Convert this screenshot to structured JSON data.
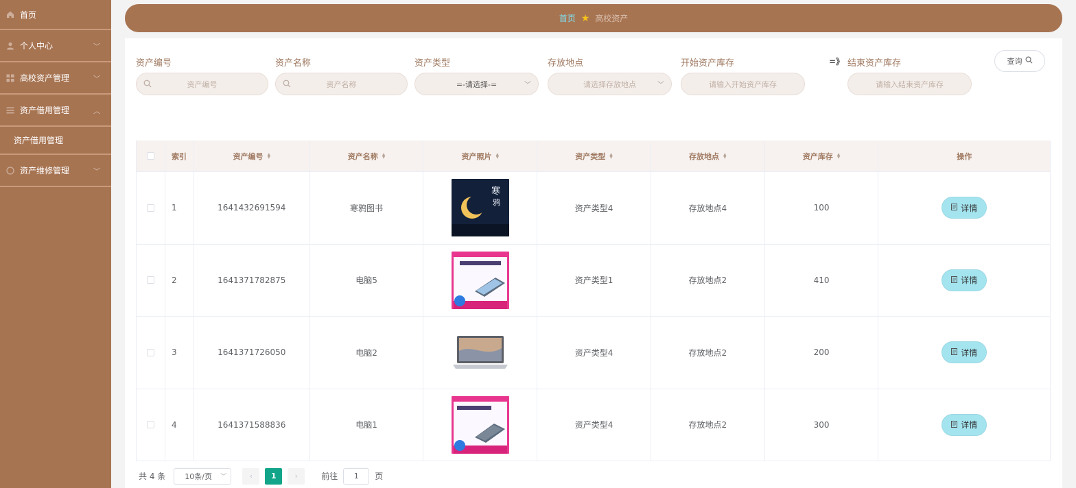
{
  "sidebar": {
    "items": [
      {
        "label": "首页",
        "icon": "home-icon"
      },
      {
        "label": "个人中心",
        "icon": "user-icon"
      },
      {
        "label": "高校资产管理",
        "icon": "grid-icon"
      },
      {
        "label": "资产借用管理",
        "icon": "list-icon"
      },
      {
        "sub_label": "资产借用管理"
      },
      {
        "label": "资产维修管理",
        "icon": "circle-icon"
      }
    ]
  },
  "breadcrumb": {
    "home": "首页",
    "current": "高校资产"
  },
  "filters": {
    "asset_no_label": "资产编号",
    "asset_no_placeholder": "资产编号",
    "asset_name_label": "资产名称",
    "asset_name_placeholder": "资产名称",
    "asset_type_label": "资产类型",
    "asset_type_value": "=-请选择-=",
    "location_label": "存放地点",
    "location_placeholder": "请选择存放地点",
    "stock_start_label": "开始资产库存",
    "stock_start_placeholder": "请输入开始资产库存",
    "range_symbol": "=》",
    "stock_end_label": "结束资产库存",
    "stock_end_placeholder": "请输入结束资产库存",
    "query_label": "查询"
  },
  "table": {
    "headers": [
      "索引",
      "资产编号",
      "资产名称",
      "资产照片",
      "资产类型",
      "存放地点",
      "资产库存",
      "操作"
    ],
    "rows": [
      {
        "index": "1",
        "asset_no": "1641432691594",
        "name": "寒鸦图书",
        "type": "资产类型4",
        "location": "存放地点4",
        "stock": "100",
        "action": "详情",
        "photo": "book-cover"
      },
      {
        "index": "2",
        "asset_no": "1641371782875",
        "name": "电脑5",
        "type": "资产类型1",
        "location": "存放地点2",
        "stock": "410",
        "action": "详情",
        "photo": "laptop-ad"
      },
      {
        "index": "3",
        "asset_no": "1641371726050",
        "name": "电脑2",
        "type": "资产类型4",
        "location": "存放地点2",
        "stock": "200",
        "action": "详情",
        "photo": "laptop"
      },
      {
        "index": "4",
        "asset_no": "1641371588836",
        "name": "电脑1",
        "type": "资产类型4",
        "location": "存放地点2",
        "stock": "300",
        "action": "详情",
        "photo": "laptop-ad"
      }
    ]
  },
  "pagination": {
    "total": "共 4 条",
    "page_size": "10条/页",
    "current_page": "1",
    "goto_prefix": "前往",
    "goto_value": "1",
    "goto_suffix": "页"
  },
  "colors": {
    "sidebar": "#a77452",
    "accent": "#12a58a",
    "detail_button": "#a3e4ef"
  }
}
